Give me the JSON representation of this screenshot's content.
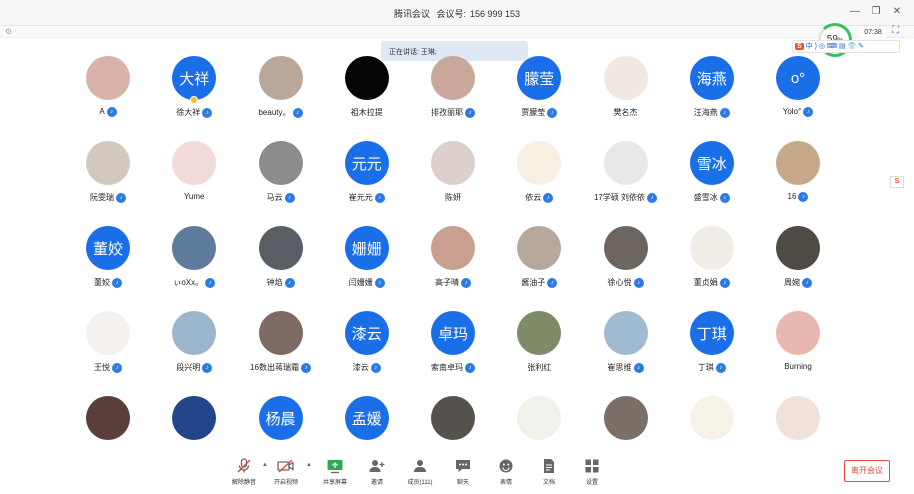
{
  "window": {
    "app_title": "腾讯会议",
    "meeting_id_label": "会议号:",
    "meeting_id": "156 999 153",
    "minimize": "—",
    "restore": "❐",
    "close": "✕"
  },
  "speaking_banner": {
    "text": "正在讲话: 王琳;"
  },
  "status": {
    "network_pct": "59",
    "pct_sign": "%",
    "time": "07:38"
  },
  "ime": {
    "label": "S",
    "icons": "中 ) ◎ ⌨ ▤ 👕 ✎",
    "side_label": "S"
  },
  "participants": [
    {
      "name": "A",
      "avatar": "photo",
      "color": "#d9b3a8"
    },
    {
      "name": "徐大祥",
      "avatar": "text",
      "text": "大祥",
      "host": true
    },
    {
      "name": "beauty。",
      "avatar": "photo",
      "color": "#b9a79a"
    },
    {
      "name": "祖木拉提",
      "avatar": "photo",
      "color": "#050505",
      "nomic": true
    },
    {
      "name": "排孜丽耶",
      "avatar": "photo",
      "color": "#c9a79a"
    },
    {
      "name": "贾朦莹",
      "avatar": "text",
      "text": "朦莹"
    },
    {
      "name": "樊名杰",
      "avatar": "photo",
      "color": "#f0e8e0",
      "nomic": true
    },
    {
      "name": "汪海燕",
      "avatar": "text",
      "text": "海燕"
    },
    {
      "name": "Yolo°",
      "avatar": "text",
      "text": "o°"
    },
    {
      "name": "阮雯瑞",
      "avatar": "photo",
      "color": "#d2c8bd"
    },
    {
      "name": "Yume",
      "avatar": "photo",
      "color": "#f3dada",
      "nomic": true
    },
    {
      "name": "马云",
      "avatar": "photo",
      "color": "#8c8c8c"
    },
    {
      "name": "崔元元",
      "avatar": "text",
      "text": "元元"
    },
    {
      "name": "陈妍",
      "avatar": "photo",
      "color": "#ddd0cc",
      "nomic": true
    },
    {
      "name": "依云",
      "avatar": "photo",
      "color": "#f6efe2"
    },
    {
      "name": "17学硕 刘依依",
      "avatar": "photo",
      "color": "#e8e8e8"
    },
    {
      "name": "盛雪冰",
      "avatar": "text",
      "text": "雪冰"
    },
    {
      "name": "16",
      "avatar": "photo",
      "color": "#c5a887"
    },
    {
      "name": "董姣",
      "avatar": "text",
      "text": "董姣"
    },
    {
      "name": "ぃoXx。",
      "avatar": "photo",
      "color": "#5f7b9b"
    },
    {
      "name": "钟焰",
      "avatar": "photo",
      "color": "#5a5f66"
    },
    {
      "name": "闫姗姗",
      "avatar": "text",
      "text": "姗姗"
    },
    {
      "name": "高子晴",
      "avatar": "photo",
      "color": "#c99f8f"
    },
    {
      "name": "酱油子",
      "avatar": "photo",
      "color": "#b6a99b"
    },
    {
      "name": "徐心悦",
      "avatar": "photo",
      "color": "#6d6660"
    },
    {
      "name": "董贞娟",
      "avatar": "photo",
      "color": "#f2ece6"
    },
    {
      "name": "周婉",
      "avatar": "photo",
      "color": "#4e4a44"
    },
    {
      "name": "王悦",
      "avatar": "photo",
      "color": "#f3f0ee"
    },
    {
      "name": "段兴明",
      "avatar": "photo",
      "color": "#9bb5cc"
    },
    {
      "name": "16数出蒋瑞霜",
      "avatar": "photo",
      "color": "#7d6a62"
    },
    {
      "name": "漆云",
      "avatar": "text",
      "text": "漆云"
    },
    {
      "name": "索南卓玛",
      "avatar": "text",
      "text": "卓玛"
    },
    {
      "name": "张利红",
      "avatar": "photo",
      "color": "#7e8a68",
      "nomic": true
    },
    {
      "name": "崔思维",
      "avatar": "photo",
      "color": "#9fbad1"
    },
    {
      "name": "丁琪",
      "avatar": "text",
      "text": "丁琪"
    },
    {
      "name": "Burning",
      "avatar": "photo",
      "color": "#e8b8b0",
      "nomic": true
    },
    {
      "name": "",
      "avatar": "photo",
      "color": "#5a3e3a"
    },
    {
      "name": "",
      "avatar": "photo",
      "color": "#23468a"
    },
    {
      "name": "",
      "avatar": "text",
      "text": "杨晨"
    },
    {
      "name": "",
      "avatar": "text",
      "text": "孟媛"
    },
    {
      "name": "",
      "avatar": "photo",
      "color": "#55524e"
    },
    {
      "name": "",
      "avatar": "photo",
      "color": "#eef2ea"
    },
    {
      "name": "",
      "avatar": "photo",
      "color": "#7c6f68"
    },
    {
      "name": "",
      "avatar": "photo",
      "color": "#f7f2e6"
    },
    {
      "name": "",
      "avatar": "photo",
      "color": "#f1e1d9"
    }
  ],
  "toolbar": {
    "unmute": "解除静音",
    "start_video": "开启视频",
    "share_screen": "共享屏幕",
    "invite": "邀请",
    "members": "成员(111)",
    "chat": "聊天",
    "emoji": "表情",
    "docs": "文档",
    "settings": "设置",
    "leave": "离开会议"
  }
}
